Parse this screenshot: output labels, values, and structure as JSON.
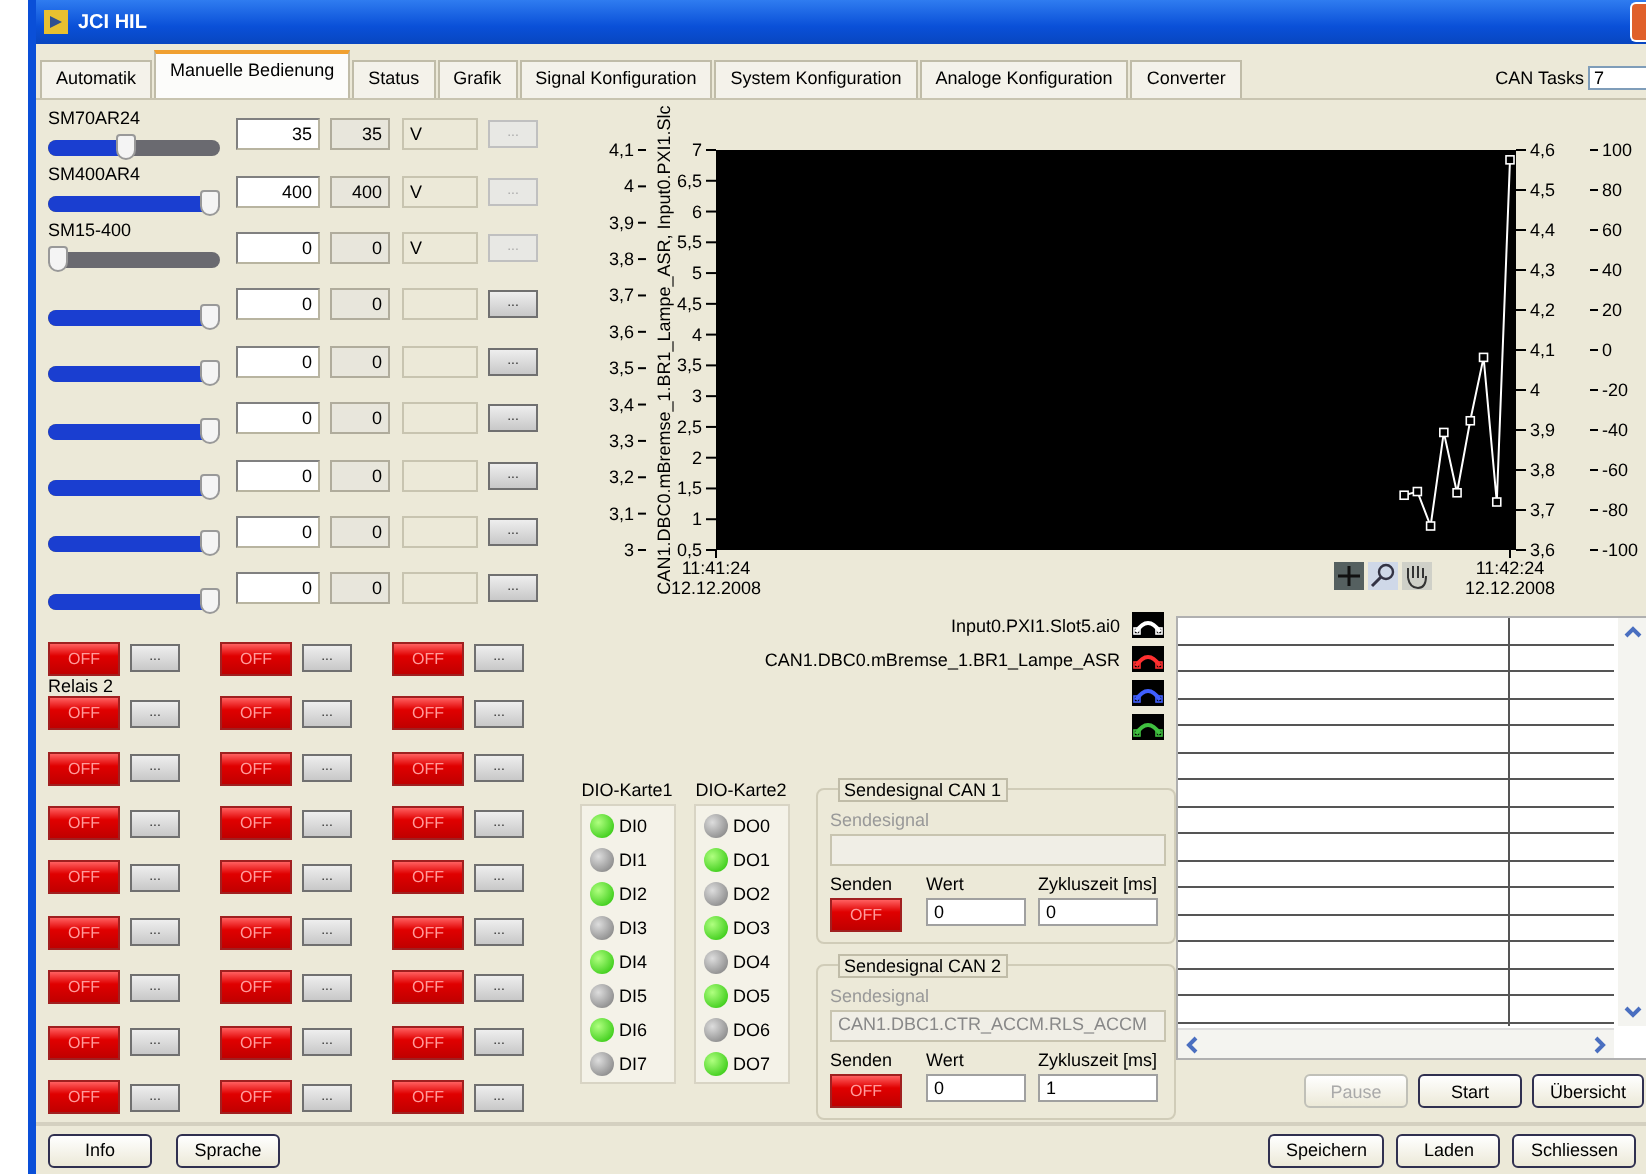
{
  "window": {
    "title": "JCI HIL"
  },
  "tabs": [
    {
      "label": "Automatik",
      "selected": false
    },
    {
      "label": "Manuelle Bedienung",
      "selected": true
    },
    {
      "label": "Status",
      "selected": false
    },
    {
      "label": "Grafik",
      "selected": false
    },
    {
      "label": "Signal Konfiguration",
      "selected": false
    },
    {
      "label": "System Konfiguration",
      "selected": false
    },
    {
      "label": "Analoge Konfiguration",
      "selected": false
    },
    {
      "label": "Converter",
      "selected": false
    }
  ],
  "can_tasks": {
    "label": "CAN Tasks",
    "value": "7"
  },
  "sliders": [
    {
      "label": "SM70AR24",
      "level": 0.45,
      "input": "35",
      "indicator": "35",
      "unit": "V",
      "button": "...",
      "disabled": true
    },
    {
      "label": "SM400AR4",
      "level": 1,
      "input": "400",
      "indicator": "400",
      "unit": "V",
      "button": "...",
      "disabled": true
    },
    {
      "label": "SM15-400",
      "level": 0,
      "input": "0",
      "indicator": "0",
      "unit": "V",
      "button": "...",
      "disabled": true
    },
    {
      "level": 1,
      "input": "0",
      "indicator": "0",
      "button": "...",
      "disabled": false
    },
    {
      "level": 1,
      "input": "0",
      "indicator": "0",
      "button": "...",
      "disabled": false
    },
    {
      "level": 1,
      "input": "0",
      "indicator": "0",
      "button": "...",
      "disabled": false
    },
    {
      "level": 1,
      "input": "0",
      "indicator": "0",
      "button": "...",
      "disabled": false
    },
    {
      "level": 1,
      "input": "0",
      "indicator": "0",
      "button": "...",
      "disabled": false
    },
    {
      "level": 1,
      "input": "0",
      "indicator": "0",
      "button": "...",
      "disabled": false
    }
  ],
  "relays": [
    {
      "switch": "OFF",
      "on": false,
      "button": "..."
    },
    {
      "switch": "OFF",
      "on": false,
      "button": "..."
    },
    {
      "switch": "OFF",
      "on": false,
      "button": "..."
    },
    {
      "label": "Relais 2",
      "switch": "OFF",
      "on": false,
      "button": "..."
    },
    {
      "switch": "OFF",
      "on": false,
      "button": "..."
    },
    {
      "switch": "OFF",
      "on": false,
      "button": "..."
    },
    {
      "switch": "OFF",
      "on": false,
      "button": "..."
    },
    {
      "switch": "OFF",
      "on": false,
      "button": "..."
    },
    {
      "switch": "OFF",
      "on": false,
      "button": "..."
    },
    {
      "switch": "OFF",
      "on": false,
      "button": "..."
    },
    {
      "switch": "OFF",
      "on": false,
      "button": "..."
    },
    {
      "switch": "OFF",
      "on": false,
      "button": "..."
    },
    {
      "switch": "OFF",
      "on": false,
      "button": "..."
    },
    {
      "switch": "OFF",
      "on": false,
      "button": "..."
    },
    {
      "switch": "OFF",
      "on": false,
      "button": "..."
    },
    {
      "switch": "OFF",
      "on": false,
      "button": "..."
    },
    {
      "switch": "OFF",
      "on": false,
      "button": "..."
    },
    {
      "switch": "OFF",
      "on": false,
      "button": "..."
    },
    {
      "switch": "OFF",
      "on": false,
      "button": "..."
    },
    {
      "switch": "OFF",
      "on": false,
      "button": "..."
    },
    {
      "switch": "OFF",
      "on": false,
      "button": "..."
    },
    {
      "switch": "OFF",
      "on": false,
      "button": "..."
    },
    {
      "switch": "OFF",
      "on": false,
      "button": "..."
    },
    {
      "switch": "OFF",
      "on": false,
      "button": "..."
    },
    {
      "switch": "OFF",
      "on": false,
      "button": "..."
    },
    {
      "switch": "OFF",
      "on": false,
      "button": "..."
    },
    {
      "switch": "OFF",
      "on": false,
      "button": "..."
    }
  ],
  "chart": {
    "axis_title": "CAN1.DBC0.mBremse_1.BR1_Lampe_ASR, Input0.PXI1.Slc",
    "outer_left_ticks": [
      "4,1",
      "4",
      "3,9",
      "3,8",
      "3,7",
      "3,6",
      "3,5",
      "3,4",
      "3,3",
      "3,2",
      "3,1",
      "3"
    ],
    "right_inner_ticks": [
      "4,6",
      "4,5",
      "4,4",
      "4,3",
      "4,2",
      "4,1",
      "4",
      "3,9",
      "3,8",
      "3,7",
      "3,6"
    ],
    "right_outer_ticks": [
      "100",
      "80",
      "60",
      "40",
      "20",
      "0",
      "-20",
      "-40",
      "-60",
      "-80",
      "-100"
    ],
    "date_labels": [
      "12.12.2008",
      "12.12.2008"
    ],
    "chart_data": {
      "type": "line",
      "categories": [
        "11:41:24",
        null,
        null,
        null,
        null,
        null,
        null,
        null,
        null,
        null,
        null,
        null,
        null,
        null,
        null,
        null,
        null,
        null,
        null,
        null,
        null,
        null,
        null,
        null,
        null,
        null,
        null,
        null,
        null,
        null,
        null,
        null,
        null,
        null,
        null,
        null,
        null,
        null,
        null,
        null,
        null,
        null,
        null,
        null,
        null,
        null,
        null,
        null,
        null,
        null,
        null,
        null,
        null,
        null,
        null,
        null,
        null,
        null,
        null,
        null,
        "11:42:24"
      ],
      "ylim": [
        0.5,
        7
      ],
      "yticks": [
        {
          "value": 7,
          "label": "7"
        },
        {
          "value": 6.5,
          "label": "6,5"
        },
        {
          "value": 6,
          "label": "6"
        },
        {
          "value": 5.5,
          "label": "5,5"
        },
        {
          "value": 5,
          "label": "5"
        },
        {
          "value": 4.5,
          "label": "4,5"
        },
        {
          "value": 4,
          "label": "4"
        },
        {
          "value": 3.5,
          "label": "3,5"
        },
        {
          "value": 3,
          "label": "3"
        },
        {
          "value": 2.5,
          "label": "2,5"
        },
        {
          "value": 2,
          "label": "2"
        },
        {
          "value": 1.5,
          "label": "1,5"
        },
        {
          "value": 1,
          "label": "1"
        },
        {
          "value": 0.5,
          "label": "0,5"
        }
      ],
      "series": [
        {
          "name": "Input0.PXI1.Slot5.ai0",
          "color": "#ffffff",
          "marker": "square",
          "values": [
            null,
            null,
            null,
            null,
            null,
            null,
            null,
            null,
            null,
            null,
            null,
            null,
            null,
            null,
            null,
            null,
            null,
            null,
            null,
            null,
            null,
            null,
            null,
            null,
            null,
            null,
            null,
            null,
            null,
            null,
            null,
            null,
            null,
            null,
            null,
            null,
            null,
            null,
            null,
            null,
            null,
            null,
            null,
            null,
            null,
            null,
            null,
            null,
            null,
            null,
            null,
            null,
            1.39,
            1.45,
            0.89,
            2.41,
            1.43,
            2.6,
            3.63,
            1.28,
            6.84
          ]
        }
      ]
    }
  },
  "legend": [
    {
      "kind": "series",
      "color": "#ffffff"
    },
    {
      "kind": "label",
      "label": "CAN1.DBC0.mBremse_1.BR1_Lampe_ASR",
      "color": "#ff3030"
    },
    {
      "kind": "label",
      "color": "#4060ff"
    },
    {
      "kind": "label",
      "color": "#40c040"
    }
  ],
  "dio": [
    {
      "title": "DIO-Karte1",
      "leds": [
        {
          "label": "DI0",
          "on": true
        },
        {
          "label": "DI1",
          "on": false
        },
        {
          "label": "DI2",
          "on": true
        },
        {
          "label": "DI3",
          "on": false
        },
        {
          "label": "DI4",
          "on": true
        },
        {
          "label": "DI5",
          "on": false
        },
        {
          "label": "DI6",
          "on": true
        },
        {
          "label": "DI7",
          "on": false
        }
      ]
    },
    {
      "title": "DIO-Karte2",
      "leds": [
        {
          "label": "DO0",
          "on": false
        },
        {
          "label": "DO1",
          "on": true
        },
        {
          "label": "DO2",
          "on": false
        },
        {
          "label": "DO3",
          "on": true
        },
        {
          "label": "DO4",
          "on": false
        },
        {
          "label": "DO5",
          "on": true
        },
        {
          "label": "DO6",
          "on": false
        },
        {
          "label": "DO7",
          "on": true
        }
      ]
    }
  ],
  "can_groups": [
    {
      "title": "Sendesignal CAN 1",
      "signal_label": "Sendesignal",
      "send_label": "Senden",
      "switch": "OFF",
      "on": false,
      "value_label": "Wert",
      "value": "0",
      "cycle_label": "Zykluszeit [ms]",
      "cycle": "0"
    },
    {
      "title": "Sendesignal CAN 2",
      "signal_label": "Sendesignal",
      "signal_value": "CAN1.DBC1.CTR_ACCM.RLS_ACCM",
      "send_label": "Senden",
      "switch": "OFF",
      "on": false,
      "value_label": "Wert",
      "value": "0",
      "cycle_label": "Zykluszeit [ms]",
      "cycle": "1"
    }
  ],
  "graph_buttons": [
    {
      "label": "Pause",
      "disabled": true
    },
    {
      "label": "Start",
      "disabled": false
    },
    {
      "label": "Übersicht",
      "disabled": false
    }
  ],
  "footer_left": [
    "Info",
    "Sprache"
  ],
  "footer_right": [
    "Speichern",
    "Laden",
    "Schliessen"
  ]
}
